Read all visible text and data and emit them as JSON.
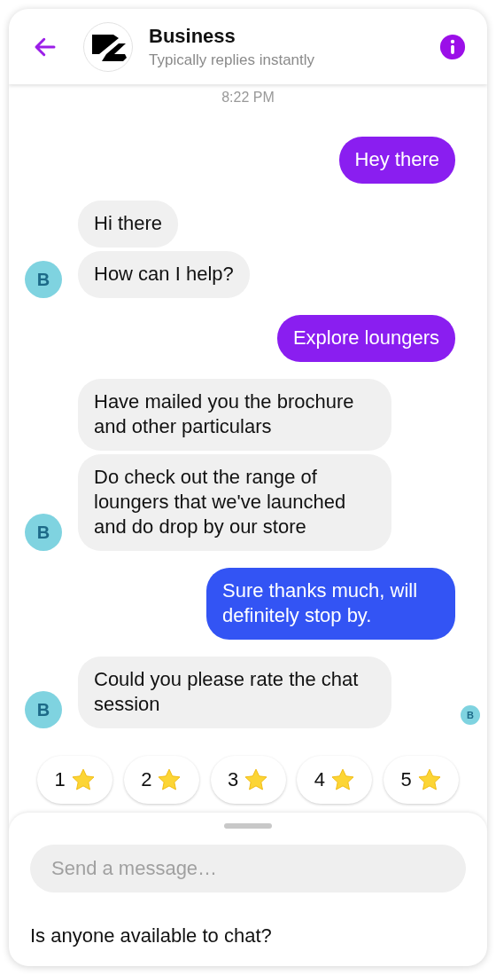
{
  "header": {
    "title": "Business",
    "subtitle": "Typically replies instantly"
  },
  "timestamp": "8:22 PM",
  "messages": [
    {
      "kind": "outgoing",
      "text": "Hey there",
      "color": "#8a1ef0"
    },
    {
      "kind": "incoming",
      "avatar": "B",
      "bubbles": [
        "Hi there",
        "How can I help?"
      ]
    },
    {
      "kind": "outgoing",
      "text": "Explore loungers",
      "color": "#8a1ef0"
    },
    {
      "kind": "incoming",
      "avatar": "B",
      "bubbles": [
        "Have mailed you the brochure and other particulars",
        "Do check out the range of loungers that we've launched and do drop by our store"
      ]
    },
    {
      "kind": "outgoing",
      "text": "Sure thanks much, will definitely stop by.",
      "color": "#3354f4"
    },
    {
      "kind": "incoming",
      "avatar": "B",
      "bubbles": [
        "Could you please rate the chat session"
      ],
      "seen_by": "B"
    }
  ],
  "quick_replies": [
    "1",
    "2",
    "3",
    "4",
    "5"
  ],
  "composer": {
    "placeholder": "Send a message…"
  },
  "suggestion": "Is anyone available to chat?"
}
